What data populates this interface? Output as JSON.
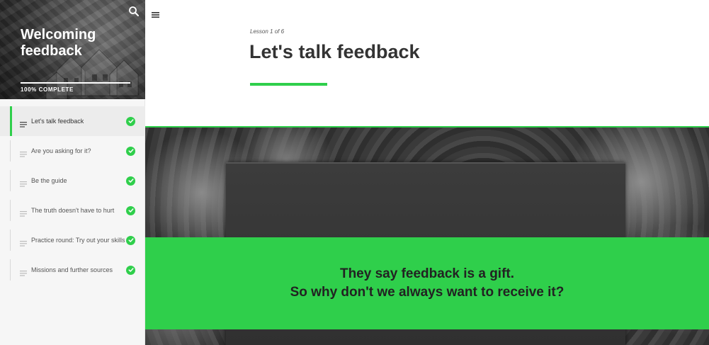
{
  "sidebar": {
    "course_title": "Welcoming feedback",
    "progress_percent": 100,
    "progress_label": "100% COMPLETE",
    "lessons": [
      {
        "label": "Let's talk feedback",
        "completed": true,
        "active": true
      },
      {
        "label": "Are you asking for it?",
        "completed": true,
        "active": false
      },
      {
        "label": "Be the guide",
        "completed": true,
        "active": false
      },
      {
        "label": "The truth doesn't have to hurt",
        "completed": true,
        "active": false
      },
      {
        "label": "Practice round: Try out your skills",
        "completed": true,
        "active": false
      },
      {
        "label": "Missions and further sources",
        "completed": true,
        "active": false
      }
    ]
  },
  "header": {
    "lesson_counter": "Lesson 1 of 6",
    "lesson_title": "Let's talk feedback"
  },
  "banner": {
    "quote_line_1": "They say feedback is a gift.",
    "quote_line_2": "So why don't we always want to receive it?"
  },
  "icons": {
    "search": "search-icon",
    "menu": "hamburger-menu-icon",
    "lesson": "lesson-lines-icon",
    "check": "check-circle-icon"
  },
  "colors": {
    "accent": "#2fcf4b",
    "text": "#333333",
    "sidebar_bg": "#f6f6f6"
  }
}
